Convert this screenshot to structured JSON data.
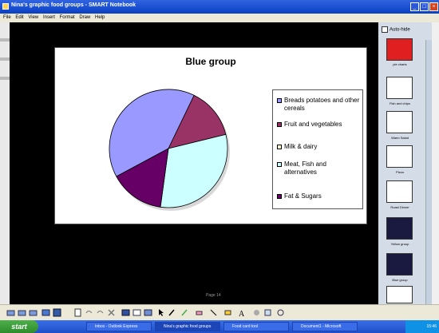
{
  "window": {
    "title": "Nina's graphic food groups - SMART Notebook",
    "controls": [
      "_",
      "□",
      "×"
    ]
  },
  "menu": [
    "File",
    "Edit",
    "View",
    "Insert",
    "Format",
    "Draw",
    "Help"
  ],
  "page_label": "Page 14",
  "sidebar": {
    "autohide_label": "Auto-hide",
    "thumbnails": [
      {
        "label": "pie charts",
        "selected": true
      },
      {
        "label": "Fish and chips"
      },
      {
        "label": "Warm Salad"
      },
      {
        "label": "Pizza"
      },
      {
        "label": "Roast Dinner"
      },
      {
        "label": "Yellow group"
      },
      {
        "label": "Blue group"
      },
      {
        "label": ""
      }
    ]
  },
  "chart_data": {
    "type": "pie",
    "title": "Blue group",
    "slices": [
      {
        "name": "Breads potatoes and other cereals",
        "value": 40,
        "color": "#9999ff"
      },
      {
        "name": "Fruit and vegetables",
        "value": 14,
        "color": "#993366"
      },
      {
        "name": "Milk & dairy",
        "value": 0,
        "color": "#ffffcc"
      },
      {
        "name": "Meat, Fish and alternatives",
        "value": 31,
        "color": "#ccffff"
      },
      {
        "name": "Fat & Sugars",
        "value": 15,
        "color": "#660066"
      }
    ],
    "legend_placement": "right"
  },
  "taskbar": {
    "start_label": "start",
    "tasks": [
      "Inbox - Outlook Express",
      "Nina's graphic food groups",
      "Food card tool",
      "Document1 - Microsoft"
    ],
    "clock": "15:46"
  }
}
